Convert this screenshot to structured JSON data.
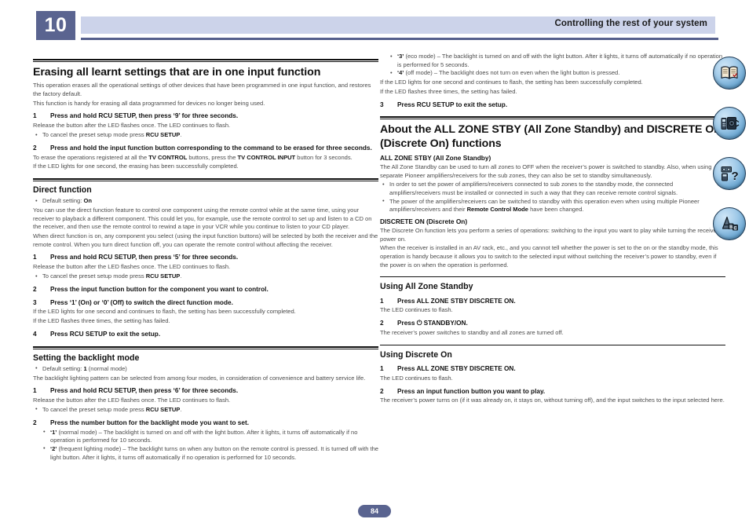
{
  "header": {
    "chapter_number": "10",
    "title": "Controlling the rest of your system"
  },
  "colors": {
    "chapter_box": "#5a6490",
    "header_bar": "#ccd3ea",
    "header_rule": "#555f8c",
    "body_text": "#4b4b4b",
    "heading_text": "#111111"
  },
  "page_number": "84",
  "side_icons": [
    {
      "name": "manual-index-icon",
      "label": "Index / open book"
    },
    {
      "name": "connections-icon",
      "label": "Connections"
    },
    {
      "name": "troubleshooting-icon",
      "label": "Troubleshooting / FAQ"
    },
    {
      "name": "glossary-icon",
      "label": "Glossary ABC"
    }
  ],
  "left_column": {
    "section1": {
      "heading": "Erasing all learnt settings that are in one input function",
      "intro1": "This operation erases all the operational settings of other devices that have been programmed in one input function, and restores the factory default.",
      "intro2": "This function is handy for erasing all data programmed for devices no longer being used.",
      "step1_num": "1",
      "step1_text": "Press and hold RCU SETUP, then press ‘9’ for three seconds.",
      "step1_body": "Release the button after the LED flashes once. The LED continues to flash.",
      "step1_bullet_pre": "To cancel the preset setup mode press ",
      "step1_bullet_bold": "RCU SETUP",
      "step1_bullet_post": ".",
      "step2_num": "2",
      "step2_text": "Press and hold the input function button corresponding to the command to be erased for three seconds.",
      "step2_body_pre": "To erase the operations registered at all the ",
      "step2_body_b1": "TV CONTROL",
      "step2_body_mid": " buttons, press the ",
      "step2_body_b2": "TV CONTROL INPUT",
      "step2_body_post": " button for 3 seconds.",
      "step2_body2": "If the LED lights for one second, the erasing has been successfully completed."
    },
    "section2": {
      "heading": "Direct function",
      "default_pre": "Default setting: ",
      "default_bold": "On",
      "para1": "You can use the direct function feature to control one component using the remote control while at the same time, using your receiver to playback a different component. This could let you, for example, use the remote control to set up and listen to a CD on the receiver, and then use the remote control to rewind a tape in your VCR while you continue to listen to your CD player.",
      "para2": "When direct function is on, any component you select (using the input function buttons) will be selected by both the receiver and the remote control. When you turn direct function off, you can operate the remote control without affecting the receiver.",
      "step1_num": "1",
      "step1_text": "Press and hold RCU SETUP, then press ‘5’ for three seconds.",
      "step1_body": "Release the button after the LED flashes once. The LED continues to flash.",
      "step1_bullet_pre": "To cancel the preset setup mode press ",
      "step1_bullet_bold": "RCU SETUP",
      "step1_bullet_post": ".",
      "step2_num": "2",
      "step2_text": "Press the input function button for the component you want to control.",
      "step3_num": "3",
      "step3_text": "Press ‘1’ (On) or ‘0’ (Off) to switch the direct function mode.",
      "step3_body1": "If the LED lights for one second and continues to flash, the setting has been successfully completed.",
      "step3_body2": "If the LED flashes three times, the setting has failed.",
      "step4_num": "4",
      "step4_text": "Press RCU SETUP to exit the setup."
    },
    "section3": {
      "heading": "Setting the backlight mode",
      "default_pre": "Default setting: ",
      "default_bold": "1",
      "default_post": " (normal mode)",
      "para1": "The backlight lighting pattern can be selected from among four modes, in consideration of convenience and battery service life.",
      "step1_num": "1",
      "step1_text": "Press and hold RCU SETUP, then press ‘6’ for three seconds.",
      "step1_body": "Release the button after the LED flashes once. The LED continues to flash.",
      "step1_bullet_pre": "To cancel the preset setup mode press ",
      "step1_bullet_bold": "RCU SETUP",
      "step1_bullet_post": ".",
      "step2_num": "2",
      "step2_text": "Press the number button for the backlight mode you want to set.",
      "mode1_bold": "‘1’",
      "mode1_text": " (normal mode) – The backlight is turned on and off with the light button. After it lights, it turns off automatically if no operation is performed for 10 seconds.",
      "mode2_bold": "‘2’",
      "mode2_text": " (frequent lighting mode) – The backlight turns on when any button on the remote control is pressed. It is turned off with the light button. After it lights, it turns off automatically if no operation is performed for 10 seconds."
    }
  },
  "right_column": {
    "continued": {
      "mode3_bold": "‘3’",
      "mode3_text": " (eco mode) – The backlight is turned on and off with the light button. After it lights, it turns off automatically if no operation is performed for 5 seconds.",
      "mode4_bold": "‘4’",
      "mode4_text": " (off mode) – The backlight does not turn on even when the light button is pressed.",
      "body1": "If the LED lights for one second and continues to flash, the setting has been successfully completed.",
      "body2": "If the LED flashes three times, the setting has failed.",
      "step3_num": "3",
      "step3_text": "Press RCU SETUP to exit the setup."
    },
    "section_about": {
      "heading": "About the ALL ZONE STBY (All Zone Standby) and DISCRETE ON (Discrete On) functions",
      "sub1": "ALL ZONE STBY (All Zone Standby)",
      "sub1_para1": "The All Zone Standby can be used to turn all zones to OFF when the receiver’s power is switched to standby. Also, when using separate Pioneer amplifiers/receivers for the sub zones, they can also be set to standby simultaneously.",
      "sub1_bullet1": "In order to set the power of amplifiers/receivers connected to sub zones to the standby mode, the connected amplifiers/receivers must be installed or connected in such a way that they can receive remote control signals.",
      "sub1_bullet2_pre": "The power of the amplifiers/receivers can be switched to standby with this operation even when using multiple Pioneer amplifiers/receivers and their ",
      "sub1_bullet2_bold": "Remote Control Mode",
      "sub1_bullet2_post": " have been changed.",
      "sub2": "DISCRETE ON (Discrete On)",
      "sub2_para1": "The Discrete On function lets you perform a series of operations: switching to the input you want to play while turning the receiver’s power on.",
      "sub2_para2": "When the receiver is installed in an AV rack, etc., and you cannot tell whether the power is set to the on or the standby mode, this operation is handy because it allows you to switch to the selected input without switching the receiver’s power to standby, even if the power is on when the operation is performed."
    },
    "section_allzone": {
      "heading": "Using All Zone Standby",
      "step1_num": "1",
      "step1_text": "Press ALL ZONE STBY DISCRETE ON.",
      "step1_body": "The LED continues to flash.",
      "step2_num": "2",
      "step2_text": "Press ⏻ STANDBY/ON.",
      "step2_body": "The receiver’s power switches to standby and all zones are turned off."
    },
    "section_discrete": {
      "heading": "Using Discrete On",
      "step1_num": "1",
      "step1_text": "Press ALL ZONE STBY DISCRETE ON.",
      "step1_body": "The LED continues to flash.",
      "step2_num": "2",
      "step2_text": "Press an input function button you want to play.",
      "step2_body": "The receiver’s power turns on (if it was already on, it stays on, without turning off), and the input switches to the input selected here."
    }
  }
}
